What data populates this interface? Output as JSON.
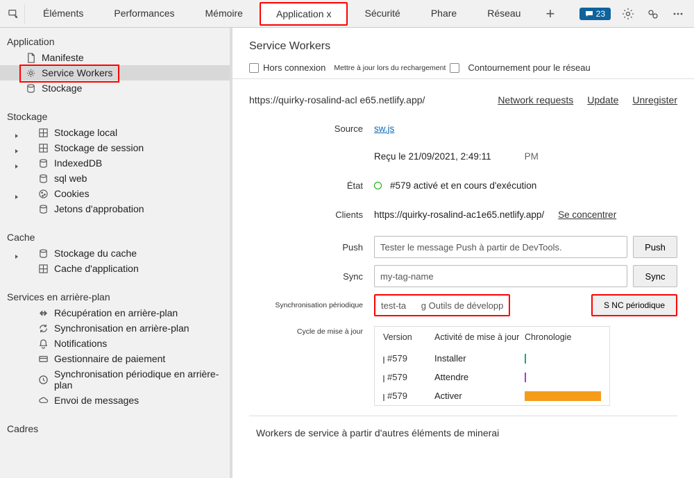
{
  "tabs": {
    "inspect_icon": "inspect",
    "items": [
      "Éléments",
      "Performances",
      "Mémoire",
      "Application",
      "Sécurité",
      "Phare",
      "Réseau"
    ],
    "active_index": 3,
    "close_marker": "x",
    "msg_count": "23"
  },
  "sidebar": {
    "sec_app": "Application",
    "app_manifest": "Manifeste",
    "app_sw": "Service Workers",
    "app_storage": "Stockage",
    "sec_storage": "Stockage",
    "st_local": "Stockage local",
    "st_session": "Stockage de session",
    "st_idb": "IndexedDB",
    "st_websql": "sql web",
    "st_cookies": "Cookies",
    "st_trust": "Jetons d'approbation",
    "sec_cache": "Cache",
    "ca_storage": "Stockage du cache",
    "ca_appcache": "Cache d'application",
    "sec_bg": "Services en arrière-plan",
    "bg_fetch": "Récupération en arrière-plan",
    "bg_sync": "Synchronisation en arrière-plan",
    "bg_notif": "Notifications",
    "bg_pay": "Gestionnaire de paiement",
    "bg_psync": "Synchronisation périodique en arrière-plan",
    "bg_push": "Envoi de messages",
    "sec_frames": "Cadres"
  },
  "sw": {
    "title": "Service Workers",
    "opt_offline": "Hors connexion",
    "opt_reload": "Mettre à jour lors du rechargement",
    "opt_bypass": "Contournement pour le réseau",
    "origin": "https://quirky-rosalind-acl e65.netlify.app/",
    "link_nr": "Network requests",
    "link_up": "Update",
    "link_un": "Unregister",
    "lbl_source": "Source",
    "val_source": "sw.js",
    "val_received": "Reçu le 21/09/2021, 2:49:11",
    "pm": "PM",
    "lbl_status": "État",
    "val_status": "#579 activé et en cours d'exécution",
    "lbl_clients": "Clients",
    "val_clients": "https://quirky-rosalind-ac1e65.netlify.app/",
    "focus": "Se concentrer",
    "lbl_push": "Push",
    "val_push": "Tester le message Push à partir de DevTools.",
    "btn_push": "Push",
    "lbl_sync": "Sync",
    "val_sync": "my-tag-name",
    "btn_sync": "Sync",
    "lbl_psync": "Synchronisation périodique",
    "val_psync": "test-ta      g Outils de développement",
    "btn_psync": "S NC périodique",
    "lbl_update": "Cycle de mise à jour",
    "tl_head_v": "Version",
    "tl_head_a": "Activité de mise à jour",
    "tl_head_t": "Chronologie",
    "tl_r1_v": "#579",
    "tl_r1_a": "Installer",
    "tl_r2_v": "#579",
    "tl_r2_a": "Attendre",
    "tl_r3_v": "#579",
    "tl_r3_a": "Activer",
    "footer": "Workers de service à partir d'autres éléments de minerai"
  }
}
